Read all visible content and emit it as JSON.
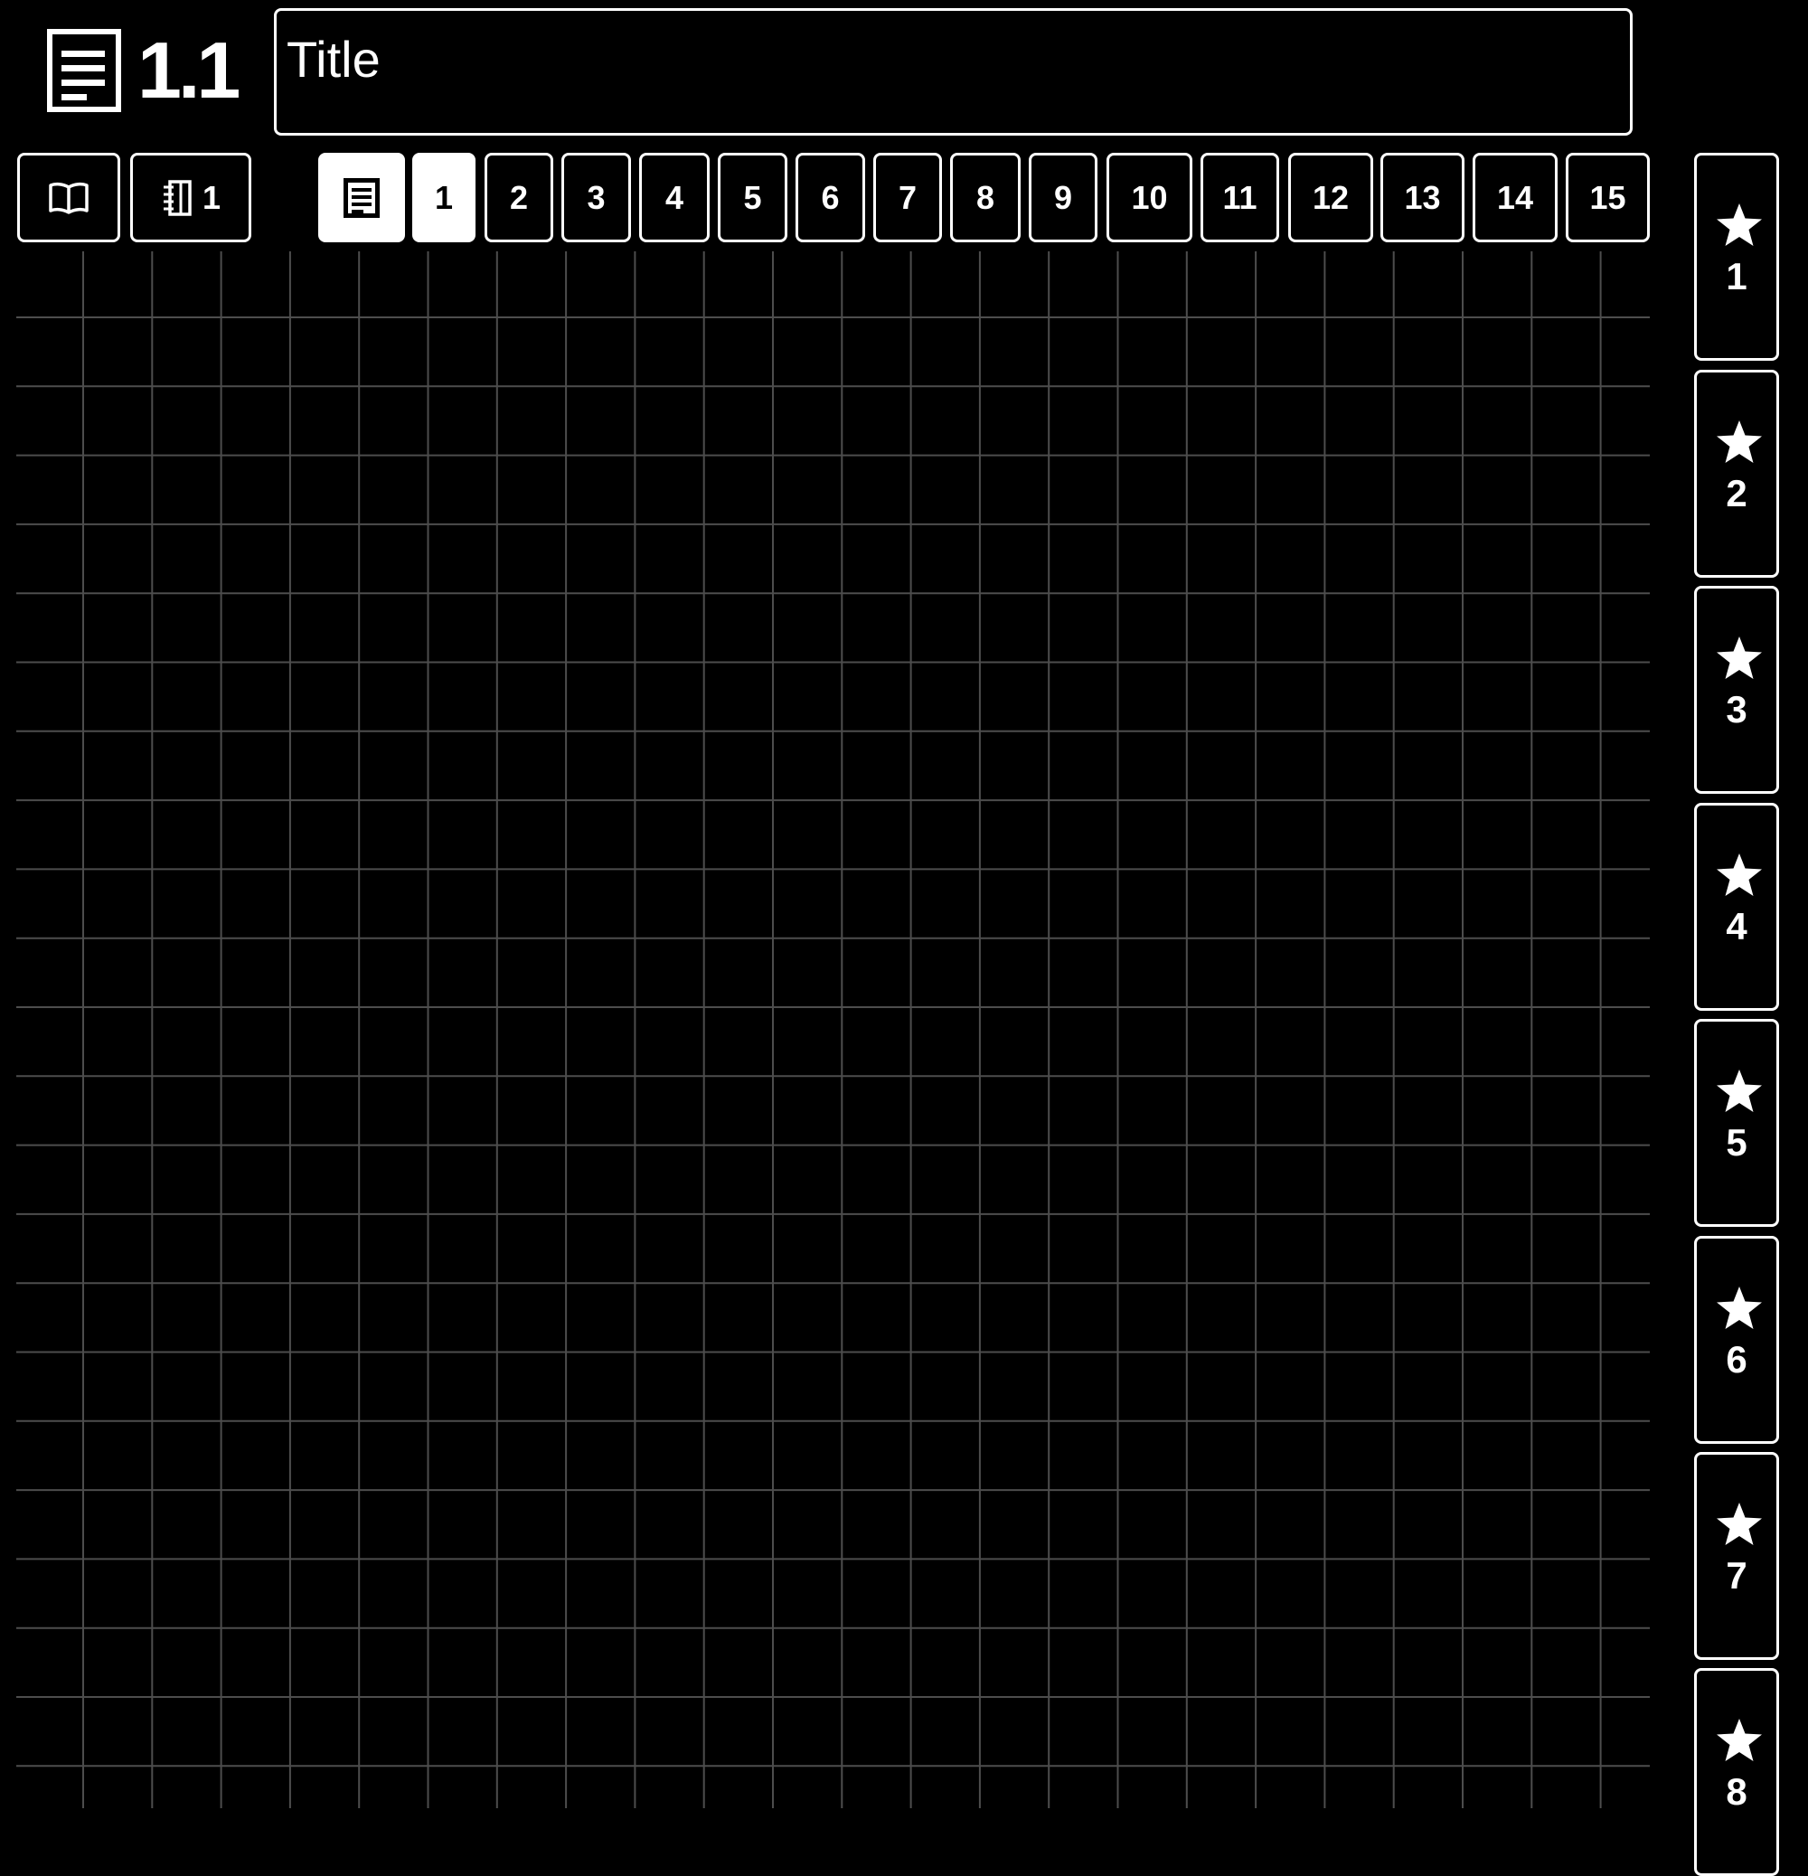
{
  "header": {
    "page_number": "1.1",
    "title_placeholder": "Title"
  },
  "toolbar": {
    "notebook_count": "1",
    "pages": [
      "1",
      "2",
      "3",
      "4",
      "5",
      "6",
      "7",
      "8",
      "9",
      "10",
      "11",
      "12",
      "13",
      "14",
      "15"
    ],
    "active_page": "1"
  },
  "bookmarks": [
    "1",
    "2",
    "3",
    "4",
    "5",
    "6",
    "7",
    "8"
  ],
  "colors": {
    "background": "#000000",
    "foreground": "#ffffff",
    "grid_line": "#4d4d4d"
  }
}
